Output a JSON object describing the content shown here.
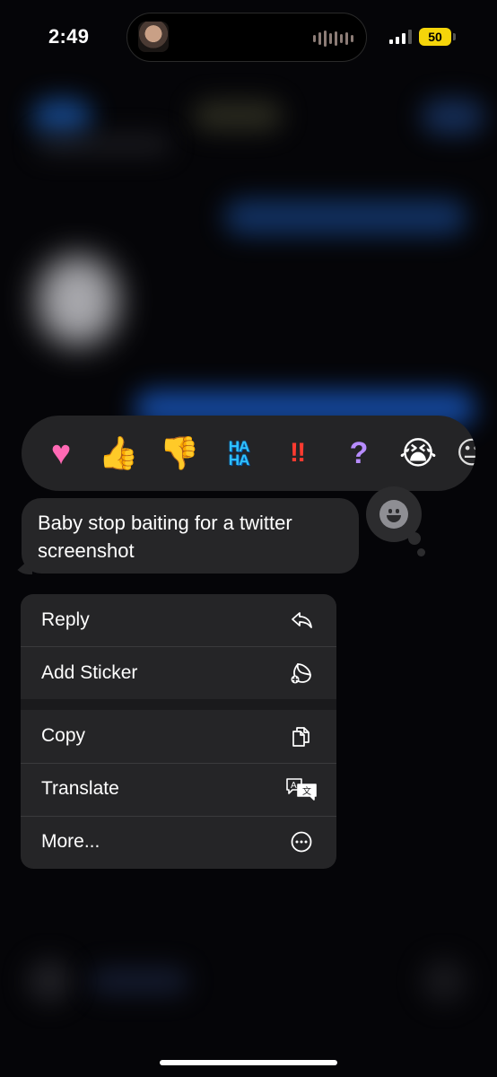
{
  "status_bar": {
    "time": "2:49",
    "battery": "50",
    "battery_color": "#f5d50a"
  },
  "reactions": [
    {
      "name": "heart",
      "glyph": "♥"
    },
    {
      "name": "thumbs-up",
      "glyph": "👍"
    },
    {
      "name": "thumbs-down",
      "glyph": "👎"
    },
    {
      "name": "haha",
      "line1": "HA",
      "line2": "HA"
    },
    {
      "name": "exclamation",
      "glyph": "‼"
    },
    {
      "name": "question",
      "glyph": "?"
    },
    {
      "name": "crying",
      "glyph": "😭"
    },
    {
      "name": "more-emoji",
      "glyph": "😐"
    }
  ],
  "message": {
    "text": "Baby stop baiting for a twitter screenshot"
  },
  "menu": {
    "items": [
      {
        "label": "Reply",
        "icon": "reply-icon"
      },
      {
        "label": "Add Sticker",
        "icon": "sticker-icon"
      },
      {
        "label": "Copy",
        "icon": "copy-icon"
      },
      {
        "label": "Translate",
        "icon": "translate-icon"
      },
      {
        "label": "More...",
        "icon": "more-icon"
      }
    ]
  },
  "colors": {
    "menu_bg": "#252527",
    "bubble_bg": "#262628",
    "reaction_bar_bg": "#242426"
  }
}
